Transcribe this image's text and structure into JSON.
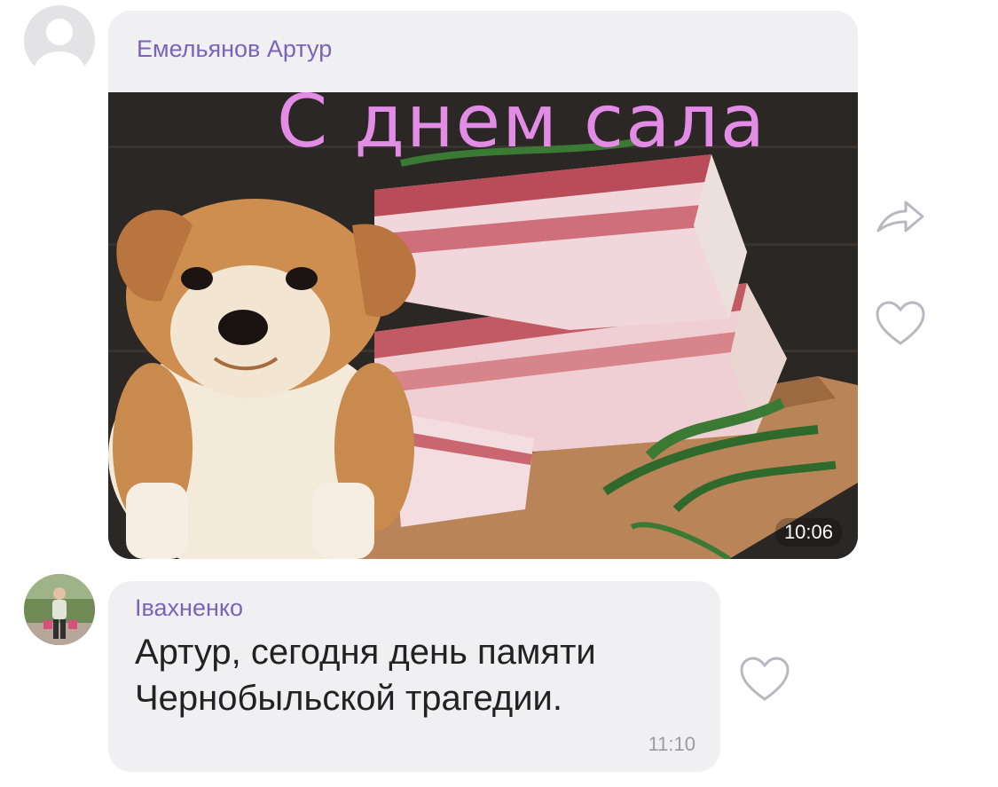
{
  "messages": [
    {
      "sender": "Емельянов Артур",
      "image_caption": "С днем сала",
      "time": "10:06",
      "avatar_icon": "default-user-icon"
    },
    {
      "sender": "Івахненко",
      "text": "Артур, сегодня день памяти Чернобыльской трагедии.",
      "time": "11:10",
      "avatar_icon": "user-photo"
    }
  ],
  "icons": {
    "forward": "forward-arrow-icon",
    "like": "heart-outline-icon"
  },
  "colors": {
    "sender": "#7b62bb",
    "bubble": "#f0f0f2",
    "caption": "#e28ce6",
    "icon": "#b8b8c0"
  }
}
